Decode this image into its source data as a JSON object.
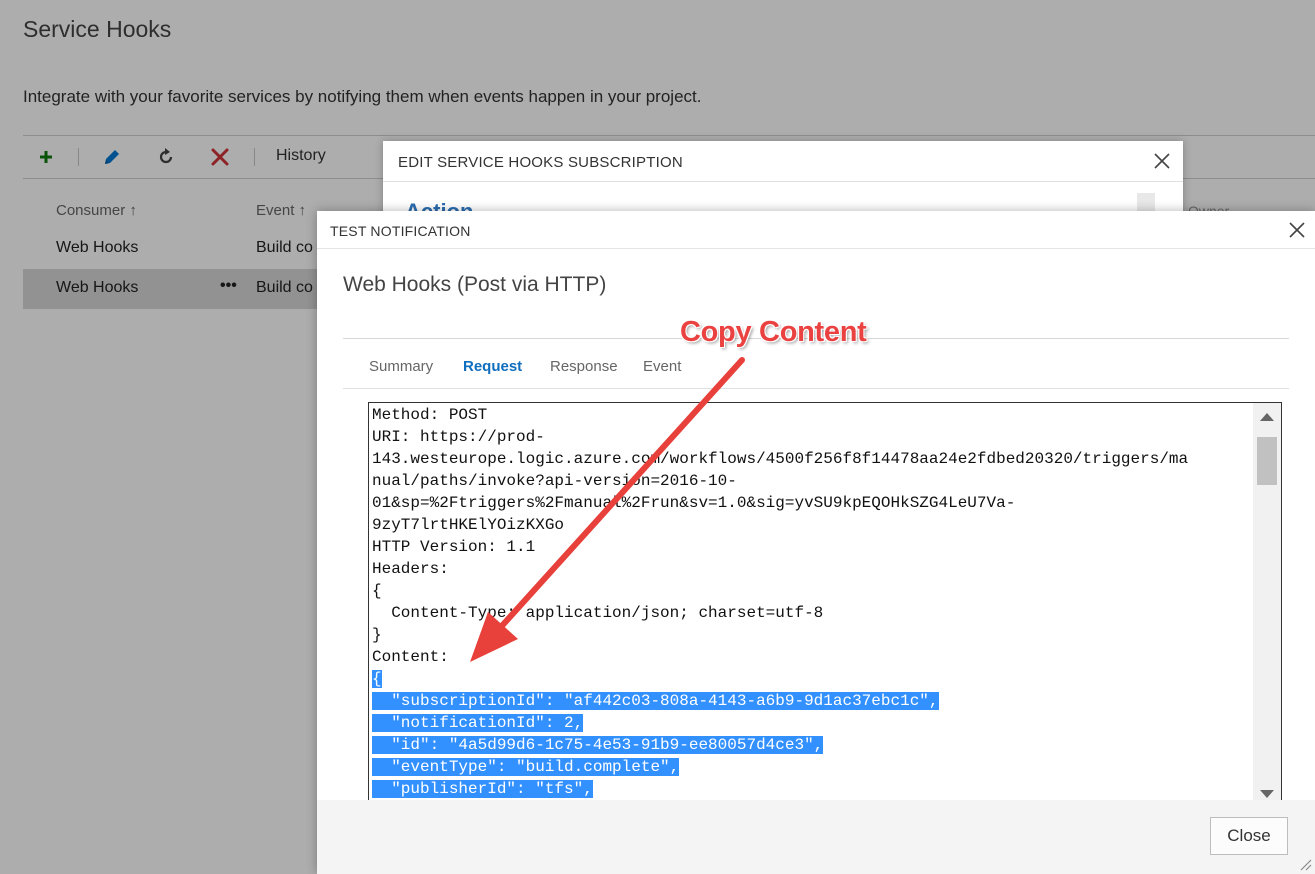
{
  "page": {
    "title": "Service Hooks",
    "description": "Integrate with your favorite services by notifying them when events happen in your project."
  },
  "toolbar": {
    "add_icon": "plus-icon",
    "edit_icon": "pencil-icon",
    "refresh_icon": "refresh-icon",
    "delete_icon": "delete-x-icon",
    "history_label": "History",
    "colors": {
      "add": "#107c10",
      "edit": "#0078d4",
      "delete": "#d13438"
    }
  },
  "table": {
    "columns": [
      "Consumer ↑",
      "Event ↑"
    ],
    "rows": [
      {
        "consumer": "Web Hooks",
        "event": "Build co",
        "more": ""
      },
      {
        "consumer": "Web Hooks",
        "event": "Build co",
        "more": "•••"
      }
    ]
  },
  "edit_dialog": {
    "title": "EDIT SERVICE HOOKS SUBSCRIPTION",
    "partial_heading": "Action",
    "partial_column": "Owner"
  },
  "test_dialog": {
    "title": "TEST NOTIFICATION",
    "subtitle": "Web Hooks (Post via HTTP)",
    "tabs": [
      {
        "label": "Summary",
        "active": false
      },
      {
        "label": "Request",
        "active": true
      },
      {
        "label": "Response",
        "active": false
      },
      {
        "label": "Event",
        "active": false
      }
    ],
    "request_lines": [
      "Method: POST",
      "URI: https://prod-",
      "143.westeurope.logic.azure.com/workflows/4500f256f8f14478aa24e2fdbed20320/triggers/ma",
      "nual/paths/invoke?api-version=2016-10-",
      "01&sp=%2Ftriggers%2Fmanual%2Frun&sv=1.0&sig=yvSU9kpEQOHkSZG4LeU7Va-",
      "9zyT7lrtHKElYOizKXGo",
      "HTTP Version: 1.1",
      "Headers:",
      "{",
      "  Content-Type: application/json; charset=utf-8",
      "}",
      "Content:"
    ],
    "content_lines": [
      "{",
      "  \"subscriptionId\": \"af442c03-808a-4143-a6b9-9d1ac37ebc1c\",",
      "  \"notificationId\": 2,",
      "  \"id\": \"4a5d99d6-1c75-4e53-91b9-ee80057d4ce3\",",
      "  \"eventType\": \"build.complete\",",
      "  \"publisherId\": \"tfs\","
    ],
    "close_label": "Close"
  },
  "annotation": {
    "label": "Copy Content",
    "color": "#ea4141"
  }
}
